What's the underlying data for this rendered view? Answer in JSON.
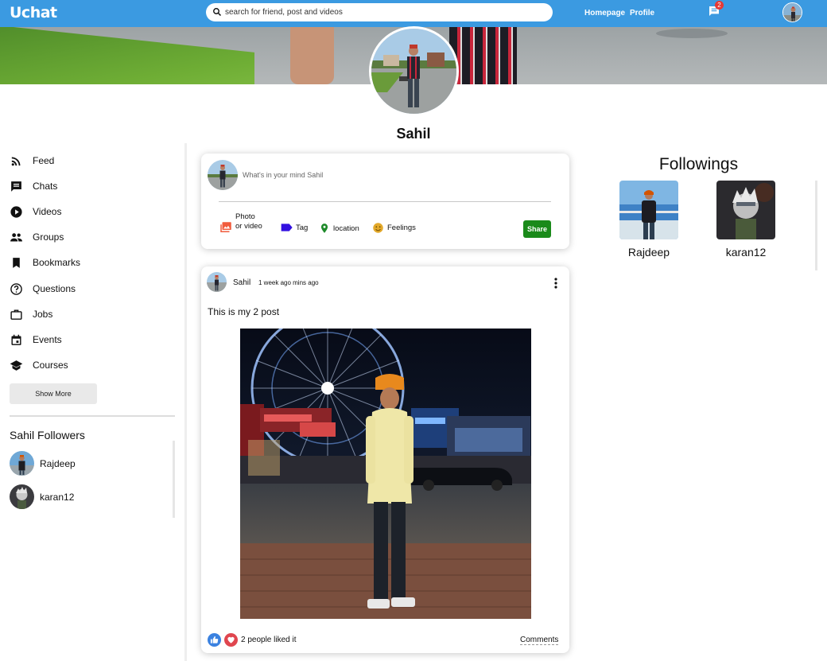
{
  "app": {
    "logo": "Uchat"
  },
  "topbar": {
    "search_placeholder": "search for friend, post and videos",
    "links": [
      "Homepage",
      "Profile"
    ],
    "chat_badge": "2",
    "icons": [
      "search-icon",
      "chat-icon",
      "avatar"
    ]
  },
  "profile": {
    "name": "Sahil"
  },
  "sidebar": {
    "items": [
      {
        "label": "Feed",
        "icon": "rss-feed-icon"
      },
      {
        "label": "Chats",
        "icon": "chat-icon"
      },
      {
        "label": "Videos",
        "icon": "play-circle-icon"
      },
      {
        "label": "Groups",
        "icon": "group-icon"
      },
      {
        "label": "Bookmarks",
        "icon": "bookmark-icon"
      },
      {
        "label": "Questions",
        "icon": "help-outline-icon"
      },
      {
        "label": "Jobs",
        "icon": "work-outline-icon"
      },
      {
        "label": "Events",
        "icon": "event-icon"
      },
      {
        "label": "Courses",
        "icon": "school-icon"
      }
    ],
    "show_more": "Show More",
    "followers_title": "Sahil Followers",
    "followers": [
      "Rajdeep",
      "karan12"
    ]
  },
  "share": {
    "placeholder": "What's in your mind Sahil",
    "options": {
      "photo": "Photo or video",
      "tag": "Tag",
      "location": "location",
      "feelings": "Feelings"
    },
    "button": "Share"
  },
  "post": {
    "user": "Sahil",
    "time": "1 week ago mins ago",
    "text": "This is my 2 post",
    "likes": "2 people liked it",
    "comments": "Comments"
  },
  "followings": {
    "title": "Followings",
    "users": [
      "Rajdeep",
      "karan12"
    ]
  },
  "colors": {
    "topbar": "#3b9ae1",
    "share_button": "#1a8a1a",
    "badge": "#e53935",
    "like_blue": "#3b82e0",
    "love_red": "#e0464f"
  }
}
